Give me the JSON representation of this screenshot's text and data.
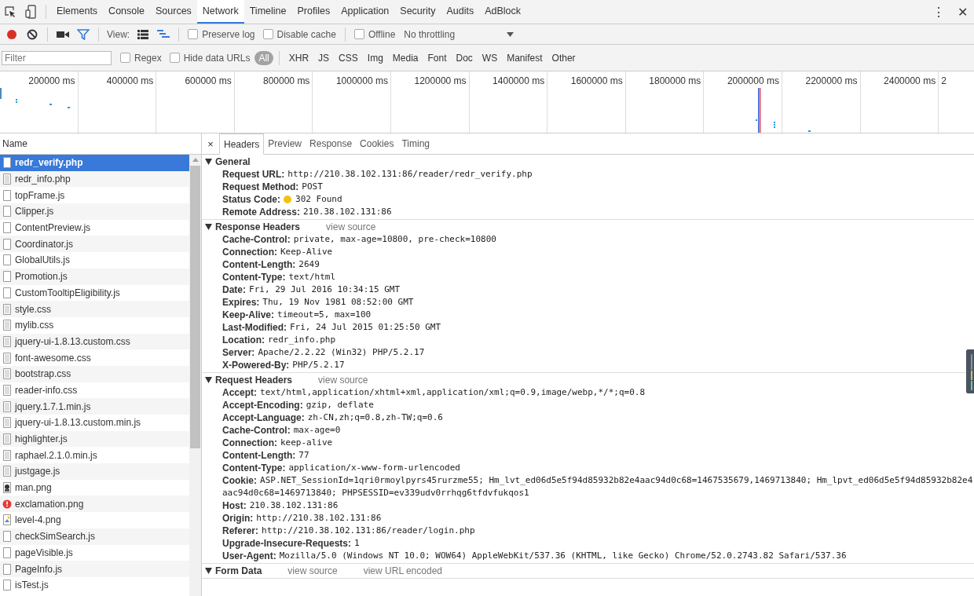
{
  "panel_tabs": [
    {
      "label": "Elements",
      "selected": false
    },
    {
      "label": "Console",
      "selected": false
    },
    {
      "label": "Sources",
      "selected": false
    },
    {
      "label": "Network",
      "selected": true
    },
    {
      "label": "Timeline",
      "selected": false
    },
    {
      "label": "Profiles",
      "selected": false
    },
    {
      "label": "Application",
      "selected": false
    },
    {
      "label": "Security",
      "selected": false
    },
    {
      "label": "Audits",
      "selected": false
    },
    {
      "label": "AdBlock",
      "selected": false
    }
  ],
  "toolbar": {
    "recording": true,
    "filter_on": true,
    "view_label": "View:",
    "checkboxes": [
      {
        "label": "Preserve log",
        "checked": false
      },
      {
        "label": "Disable cache",
        "checked": false
      }
    ],
    "offline": {
      "label": "Offline",
      "checked": false
    },
    "throttling": "No throttling"
  },
  "filter_bar": {
    "placeholder": "Filter",
    "checkboxes": [
      {
        "label": "Regex",
        "checked": false
      },
      {
        "label": "Hide data URLs",
        "checked": false
      }
    ],
    "types": [
      {
        "label": "All",
        "selected": true
      },
      {
        "label": "XHR",
        "selected": false
      },
      {
        "label": "JS",
        "selected": false
      },
      {
        "label": "CSS",
        "selected": false
      },
      {
        "label": "Img",
        "selected": false
      },
      {
        "label": "Media",
        "selected": false
      },
      {
        "label": "Font",
        "selected": false
      },
      {
        "label": "Doc",
        "selected": false
      },
      {
        "label": "WS",
        "selected": false
      },
      {
        "label": "Manifest",
        "selected": false
      },
      {
        "label": "Other",
        "selected": false
      }
    ]
  },
  "overview": {
    "ticks": [
      "200000 ms",
      "400000 ms",
      "600000 ms",
      "800000 ms",
      "1000000 ms",
      "1200000 ms",
      "1400000 ms",
      "1600000 ms",
      "1800000 ms",
      "2000000 ms",
      "2200000 ms",
      "2400000 ms",
      "2"
    ]
  },
  "requests": {
    "column": "Name",
    "rows": [
      {
        "name": "redr_verify.php",
        "kind": "doc",
        "selected": true
      },
      {
        "name": "redr_info.php",
        "kind": "file",
        "selected": false
      },
      {
        "name": "topFrame.js",
        "kind": "doc",
        "selected": false
      },
      {
        "name": "Clipper.js",
        "kind": "doc",
        "selected": false
      },
      {
        "name": "ContentPreview.js",
        "kind": "doc",
        "selected": false
      },
      {
        "name": "Coordinator.js",
        "kind": "doc",
        "selected": false
      },
      {
        "name": "GlobalUtils.js",
        "kind": "doc",
        "selected": false
      },
      {
        "name": "Promotion.js",
        "kind": "doc",
        "selected": false
      },
      {
        "name": "CustomTooltipEligibility.js",
        "kind": "doc",
        "selected": false
      },
      {
        "name": "style.css",
        "kind": "file",
        "selected": false
      },
      {
        "name": "mylib.css",
        "kind": "file",
        "selected": false
      },
      {
        "name": "jquery-ui-1.8.13.custom.css",
        "kind": "file",
        "selected": false
      },
      {
        "name": "font-awesome.css",
        "kind": "file",
        "selected": false
      },
      {
        "name": "bootstrap.css",
        "kind": "file",
        "selected": false
      },
      {
        "name": "reader-info.css",
        "kind": "file",
        "selected": false
      },
      {
        "name": "jquery.1.7.1.min.js",
        "kind": "file",
        "selected": false
      },
      {
        "name": "jquery-ui-1.8.13.custom.min.js",
        "kind": "file",
        "selected": false
      },
      {
        "name": "highlighter.js",
        "kind": "file",
        "selected": false
      },
      {
        "name": "raphael.2.1.0.min.js",
        "kind": "file",
        "selected": false
      },
      {
        "name": "justgage.js",
        "kind": "file",
        "selected": false
      },
      {
        "name": "man.png",
        "kind": "person",
        "selected": false
      },
      {
        "name": "exclamation.png",
        "kind": "alert",
        "selected": false
      },
      {
        "name": "level-4.png",
        "kind": "thumb",
        "selected": false
      },
      {
        "name": "checkSimSearch.js",
        "kind": "doc",
        "selected": false
      },
      {
        "name": "pageVisible.js",
        "kind": "doc",
        "selected": false
      },
      {
        "name": "PageInfo.js",
        "kind": "doc",
        "selected": false
      },
      {
        "name": "isTest.js",
        "kind": "doc",
        "selected": false
      }
    ]
  },
  "detail": {
    "close": "×",
    "tabs": [
      {
        "label": "Headers",
        "selected": true
      },
      {
        "label": "Preview",
        "selected": false
      },
      {
        "label": "Response",
        "selected": false
      },
      {
        "label": "Cookies",
        "selected": false
      },
      {
        "label": "Timing",
        "selected": false
      }
    ],
    "sections": [
      {
        "title": "General",
        "expanded": true,
        "headers": [
          {
            "name": "Request URL:",
            "value": "http://210.38.102.131:86/reader/redr_verify.php"
          },
          {
            "name": "Request Method:",
            "value": "POST"
          },
          {
            "name": "Status Code:",
            "value": "302 Found",
            "kind": "status"
          },
          {
            "name": "Remote Address:",
            "value": "210.38.102.131:86"
          }
        ]
      },
      {
        "title": "Response Headers",
        "expanded": true,
        "links": [
          "view source"
        ],
        "headers": [
          {
            "name": "Cache-Control:",
            "value": "private, max-age=10800, pre-check=10800"
          },
          {
            "name": "Connection:",
            "value": "Keep-Alive"
          },
          {
            "name": "Content-Length:",
            "value": "2649"
          },
          {
            "name": "Content-Type:",
            "value": "text/html"
          },
          {
            "name": "Date:",
            "value": "Fri, 29 Jul 2016 10:34:15 GMT"
          },
          {
            "name": "Expires:",
            "value": "Thu, 19 Nov 1981 08:52:00 GMT"
          },
          {
            "name": "Keep-Alive:",
            "value": "timeout=5, max=100"
          },
          {
            "name": "Last-Modified:",
            "value": "Fri, 24 Jul 2015 01:25:50 GMT"
          },
          {
            "name": "Location:",
            "value": "redr_info.php"
          },
          {
            "name": "Server:",
            "value": "Apache/2.2.22 (Win32) PHP/5.2.17"
          },
          {
            "name": "X-Powered-By:",
            "value": "PHP/5.2.17"
          }
        ]
      },
      {
        "title": "Request Headers",
        "expanded": true,
        "links": [
          "view source"
        ],
        "headers": [
          {
            "name": "Accept:",
            "value": "text/html,application/xhtml+xml,application/xml;q=0.9,image/webp,*/*;q=0.8"
          },
          {
            "name": "Accept-Encoding:",
            "value": "gzip, deflate"
          },
          {
            "name": "Accept-Language:",
            "value": "zh-CN,zh;q=0.8,zh-TW;q=0.6"
          },
          {
            "name": "Cache-Control:",
            "value": "max-age=0"
          },
          {
            "name": "Connection:",
            "value": "keep-alive"
          },
          {
            "name": "Content-Length:",
            "value": "77"
          },
          {
            "name": "Content-Type:",
            "value": "application/x-www-form-urlencoded"
          },
          {
            "name": "Cookie:",
            "value": "ASP.NET_SessionId=1qri0rmoylpyrs45rurzme55; Hm_lvt_ed06d5e5f94d85932b82e4aac94d0c68=1467535679,1469713840; Hm_lpvt_ed06d5e5f94d85932b82e4aac94d0c68=1469713840; PHPSESSID=ev339udv0rrhqg6tfdvfukqos1"
          },
          {
            "name": "Host:",
            "value": "210.38.102.131:86"
          },
          {
            "name": "Origin:",
            "value": "http://210.38.102.131:86"
          },
          {
            "name": "Referer:",
            "value": "http://210.38.102.131:86/reader/login.php"
          },
          {
            "name": "Upgrade-Insecure-Requests:",
            "value": "1"
          },
          {
            "name": "User-Agent:",
            "value": "Mozilla/5.0 (Windows NT 10.0; WOW64) AppleWebKit/537.36 (KHTML, like Gecko) Chrome/52.0.2743.82 Safari/537.36"
          }
        ]
      },
      {
        "title": "Form Data",
        "expanded": true,
        "links": [
          "view source",
          "view URL encoded"
        ]
      }
    ]
  },
  "window_controls": {
    "more": "⋮",
    "close": "✕"
  }
}
